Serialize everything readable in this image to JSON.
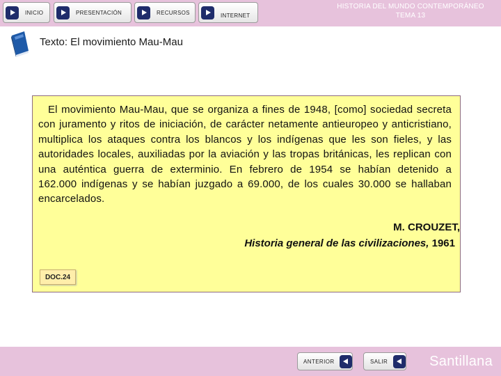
{
  "nav": {
    "items": [
      {
        "label": "INICIO",
        "icon": "play-arrow-icon"
      },
      {
        "label": "PRESENTACIÓN",
        "icon": "play-arrow-icon"
      },
      {
        "label": "RECURSOS",
        "icon": "play-arrow-icon"
      },
      {
        "label": "INTERNET",
        "icon": "play-arrow-icon"
      }
    ]
  },
  "header": {
    "title_line1": "HISTORIA DEL MUNDO CONTEMPORÁNEO",
    "title_line2": "TEMA 13"
  },
  "section": {
    "title": "Texto: El movimiento Mau-Mau",
    "icon": "book-icon"
  },
  "document": {
    "text": "El movimiento Mau-Mau, que se organiza a fines de 1948, [como] sociedad secreta con juramento y ritos de iniciación, de carácter netamente antieuropeo y anticristiano, multiplica los ataques contra los blancos y los indígenas que les son fieles, y las autoridades locales, auxiliadas por la aviación y las tropas británicas, les replican con una auténtica guerra de exterminio. En febrero de 1954 se habían detenido a 162.000 indígenas y se habían juzgado a 69.000, de los cuales 30.000 se hallaban encarcelados.",
    "author": "M. CROUZET,",
    "book_title": "Historia general de las civilizaciones,",
    "book_year": "1961",
    "tag": "DOC.24",
    "background": "#ffff99"
  },
  "footer": {
    "prev_label": "ANTERIOR",
    "exit_label": "SALIR",
    "brand": "Santillana"
  },
  "colors": {
    "band": "#e7c2dc",
    "nav_arrow": "#1f2c6b"
  }
}
